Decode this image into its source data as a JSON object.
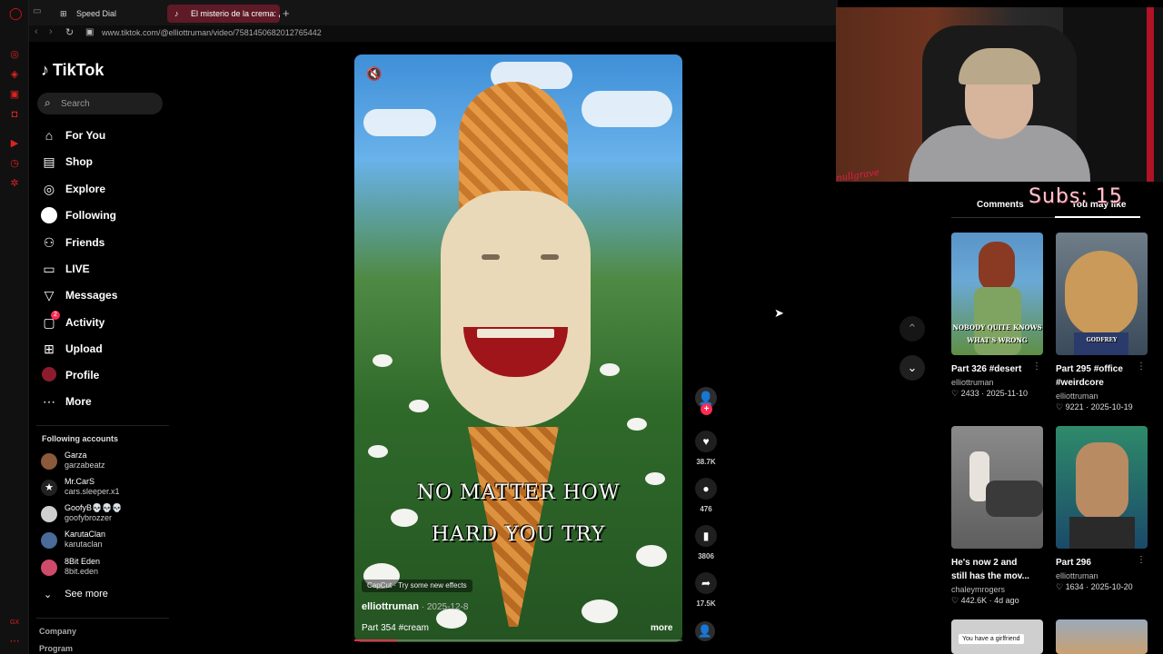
{
  "browser": {
    "tabs": [
      {
        "label": "Speed Dial"
      },
      {
        "label": "El misterio de la crema: ¿P"
      }
    ],
    "url": "www.tiktok.com/@elliottruman/video/7581450682012765442"
  },
  "sidebar": {
    "logo": "TikTok",
    "search_placeholder": "Search",
    "nav": [
      {
        "label": "For You",
        "icon": "home-icon"
      },
      {
        "label": "Shop",
        "icon": "shop-bag-icon"
      },
      {
        "label": "Explore",
        "icon": "compass-icon"
      },
      {
        "label": "Following",
        "icon": "following-avatar-icon"
      },
      {
        "label": "Friends",
        "icon": "friends-icon"
      },
      {
        "label": "LIVE",
        "icon": "live-tv-icon"
      },
      {
        "label": "Messages",
        "icon": "messages-icon"
      },
      {
        "label": "Activity",
        "icon": "activity-icon",
        "badge": "2"
      },
      {
        "label": "Upload",
        "icon": "upload-icon"
      },
      {
        "label": "Profile",
        "icon": "profile-avatar-icon"
      },
      {
        "label": "More",
        "icon": "more-dots-icon"
      }
    ],
    "following_title": "Following accounts",
    "accounts": [
      {
        "name": "Garza",
        "handle": "garzabeatz",
        "color": "#8a5a3a"
      },
      {
        "name": "Mr.CarS",
        "handle": "cars.sleeper.x1",
        "color": "#222222"
      },
      {
        "name": "GoofyB💀💀💀",
        "handle": "goofybrozzer",
        "color": "#cfcfcf"
      },
      {
        "name": "KarutaClan",
        "handle": "karutaclan",
        "color": "#4a6a9a"
      },
      {
        "name": "8Bit Eden",
        "handle": "8bit.eden",
        "color": "#d04a6a"
      }
    ],
    "see_more": "See more",
    "footer": [
      "Company",
      "Program"
    ]
  },
  "video": {
    "caption_line1": "NO MATTER HOW",
    "caption_line2": "HARD YOU TRY",
    "capcut": "CapCut · Try some new effects",
    "author": "elliottruman",
    "date": " · 2025-12-8",
    "description": "Part 354 #cream",
    "more": "more",
    "progress": 0.13
  },
  "actions": {
    "likes": "38.7K",
    "comments": "476",
    "saves": "3806",
    "shares": "17.5K"
  },
  "overlay": {
    "signature": "nullgrave",
    "subs": "Subs: 15"
  },
  "right_panel": {
    "tab_comments": "Comments",
    "tab_may_like": "You may like",
    "cards": [
      {
        "title": "Part 326 #desert",
        "author": "elliottruman",
        "meta": "♡ 2433 · 2025-11-10",
        "thumb_text": "NOBODY QUITE KNOWS WHAT'S WRONG"
      },
      {
        "title": "Part 295 #office #weirdcore",
        "author": "elliottruman",
        "meta": "♡ 9221 · 2025-10-19",
        "thumb_text": "GODFREY"
      },
      {
        "title": "He's now 2 and still has the mov...",
        "author": "chaleymrogers",
        "meta": "♡ 442.6K · 4d ago",
        "thumb_text": ""
      },
      {
        "title": "Part 296",
        "author": "elliottruman",
        "meta": "♡ 1634 · 2025-10-20",
        "thumb_text": ""
      },
      {
        "title": "",
        "author": "",
        "meta": "",
        "thumb_text": "You have a girlfriend"
      }
    ]
  }
}
